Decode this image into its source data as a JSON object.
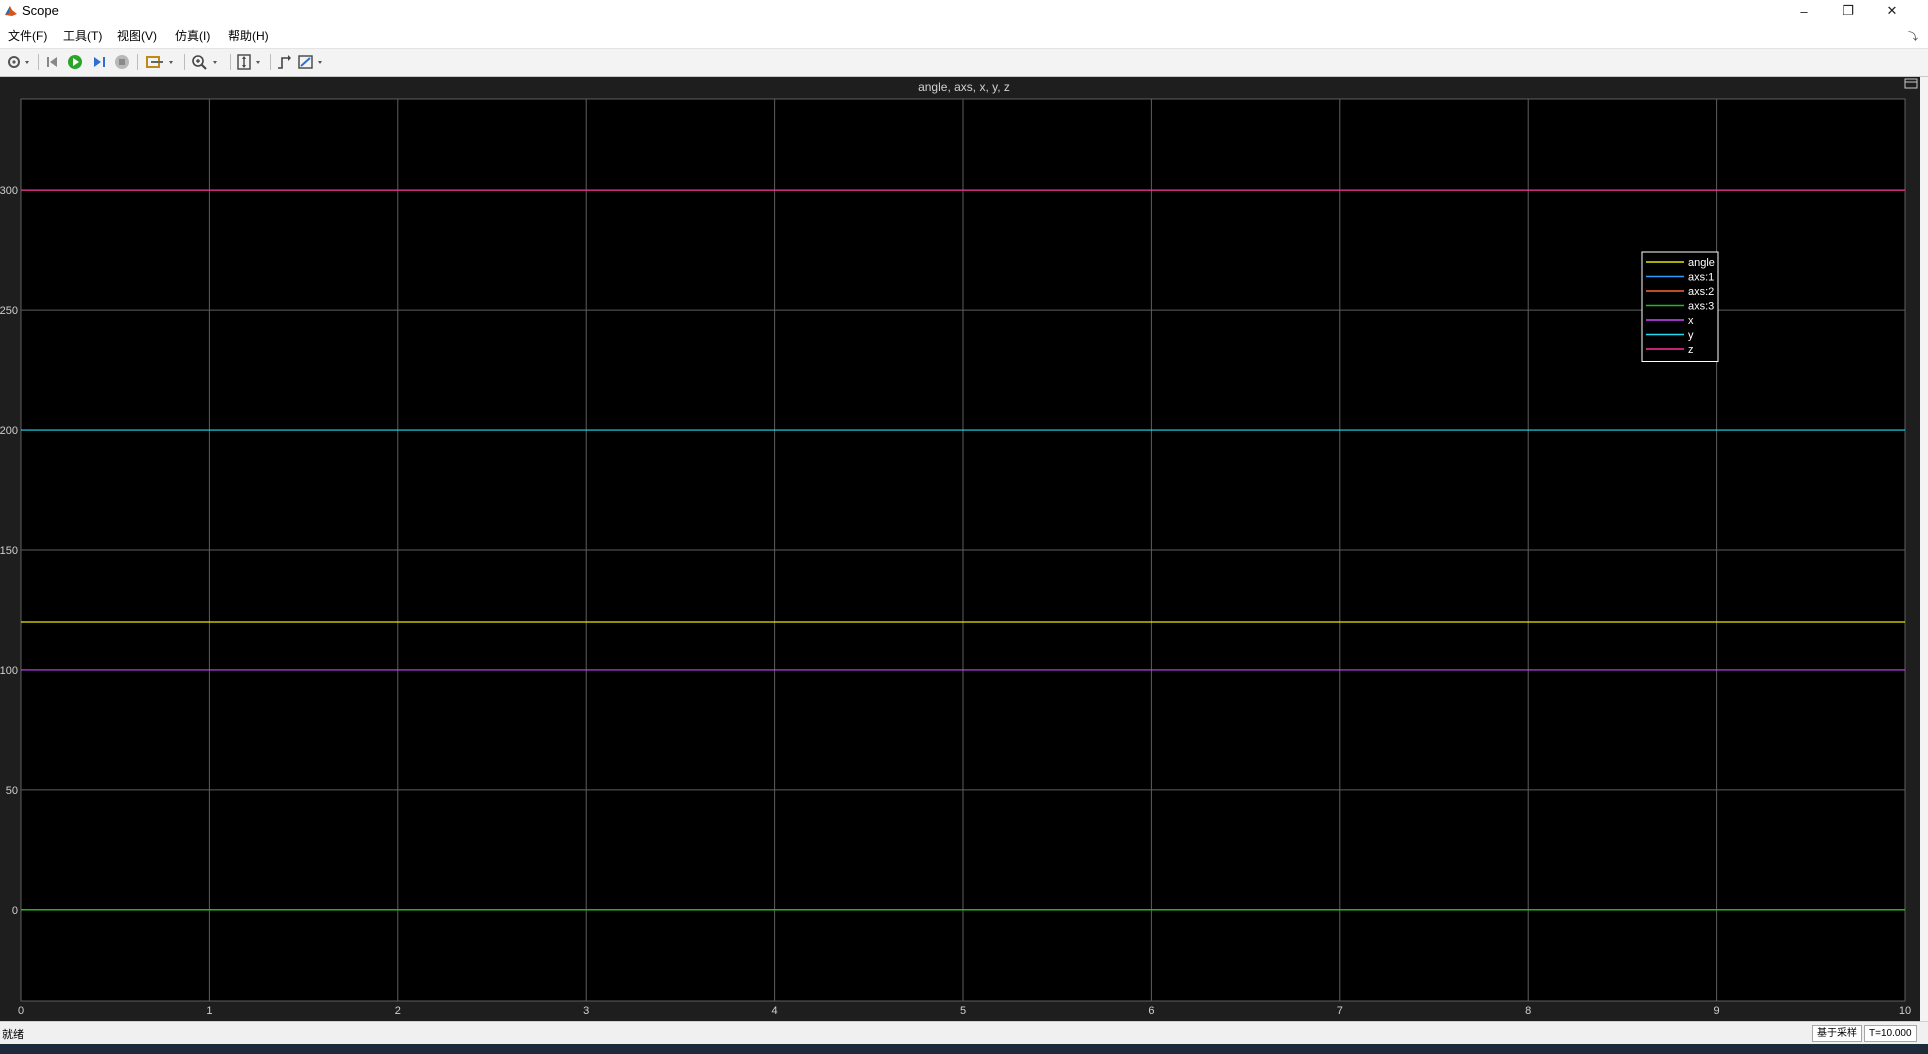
{
  "window": {
    "title": "Scope",
    "buttons": {
      "minimize": "–",
      "restore": "❐",
      "close": "✕"
    }
  },
  "menu": [
    "文件(F)",
    "工具(T)",
    "视图(V)",
    "仿真(I)",
    "帮助(H)"
  ],
  "toolbar": {
    "icons": [
      "gear-icon",
      "step-back-icon",
      "run-icon",
      "step-forward-icon",
      "stop-icon",
      "highlight-icon",
      "zoom-icon",
      "autoscale-icon",
      "trigger-icon",
      "style-icon"
    ]
  },
  "status": {
    "left": "就绪",
    "sample_mode": "基于采样",
    "time": "T=10.000"
  },
  "colors": {
    "plot_bg": "#000000",
    "figure_bg": "#1e1e1e",
    "grid": "#5e5e5e",
    "axis_text": "#d0d0d0"
  },
  "chart_data": {
    "type": "line",
    "title": "angle, axs, x, y, z",
    "xlabel": "",
    "ylabel": "",
    "xlim": [
      0,
      10
    ],
    "ylim": [
      -38,
      338
    ],
    "xticks": [
      0,
      1,
      2,
      3,
      4,
      5,
      6,
      7,
      8,
      9,
      10
    ],
    "yticks": [
      0,
      50,
      100,
      150,
      200,
      250,
      300
    ],
    "grid": true,
    "legend_position": "top-right",
    "series": [
      {
        "name": "angle",
        "color": "#e6e600",
        "x": [
          0,
          10
        ],
        "y": [
          120,
          120
        ]
      },
      {
        "name": "axs:1",
        "color": "#3399ff",
        "x": [
          0,
          10
        ],
        "y": [
          0,
          0
        ]
      },
      {
        "name": "axs:2",
        "color": "#ff6633",
        "x": [
          0,
          10
        ],
        "y": [
          0,
          0
        ]
      },
      {
        "name": "axs:3",
        "color": "#22bb22",
        "x": [
          0,
          10
        ],
        "y": [
          0,
          0
        ]
      },
      {
        "name": "x",
        "color": "#cc44ff",
        "x": [
          0,
          10
        ],
        "y": [
          100,
          100
        ]
      },
      {
        "name": "y",
        "color": "#22ddee",
        "x": [
          0,
          10
        ],
        "y": [
          200,
          200
        ]
      },
      {
        "name": "z",
        "color": "#ff3399",
        "x": [
          0,
          10
        ],
        "y": [
          300,
          300
        ]
      }
    ]
  }
}
